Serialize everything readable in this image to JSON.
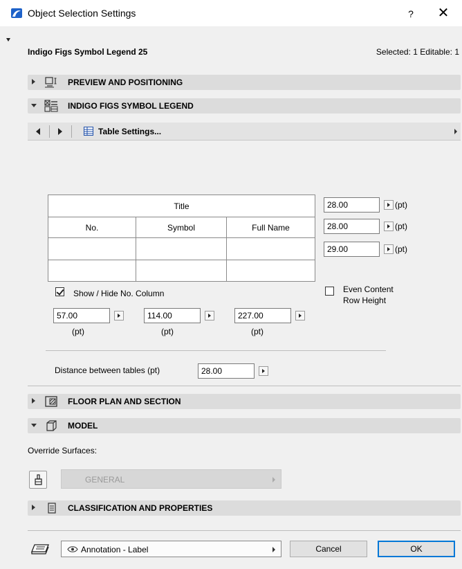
{
  "window": {
    "title": "Object Selection Settings",
    "help": "?",
    "close": "✕"
  },
  "header": {
    "object_name": "Indigo Figs Symbol Legend 25",
    "selection_status": "Selected: 1 Editable: 1"
  },
  "sections": {
    "preview": "PREVIEW AND POSITIONING",
    "legend": "INDIGO FIGS SYMBOL LEGEND",
    "floor_plan": "FLOOR PLAN AND SECTION",
    "model": "MODEL",
    "classification": "CLASSIFICATION AND PROPERTIES"
  },
  "navbar": {
    "page_label": "Table Settings..."
  },
  "legend_table": {
    "title": "Title",
    "columns": [
      "No.",
      "Symbol",
      "Full Name"
    ],
    "row_heights": [
      {
        "value": "28.00",
        "unit": "(pt)"
      },
      {
        "value": "28.00",
        "unit": "(pt)"
      },
      {
        "value": "29.00",
        "unit": "(pt)"
      }
    ],
    "show_hide_label": "Show / Hide No. Column",
    "show_hide_checked": true,
    "even_content_label_1": "Even Content",
    "even_content_label_2": "Row Height",
    "even_content_checked": false,
    "column_widths": [
      {
        "value": "57.00",
        "unit": "(pt)"
      },
      {
        "value": "114.00",
        "unit": "(pt)"
      },
      {
        "value": "227.00",
        "unit": "(pt)"
      }
    ],
    "distance_label": "Distance between tables (pt)",
    "distance_value": "28.00"
  },
  "model": {
    "override_label": "Override Surfaces:",
    "surface_value": "GENERAL"
  },
  "footer": {
    "layer_value": "Annotation - Label",
    "cancel_label": "Cancel",
    "ok_label": "OK"
  },
  "colors": {
    "section_bg": "#dcdcdc",
    "ok_border": "#0078d7",
    "app_icon": "#1e62c9"
  }
}
